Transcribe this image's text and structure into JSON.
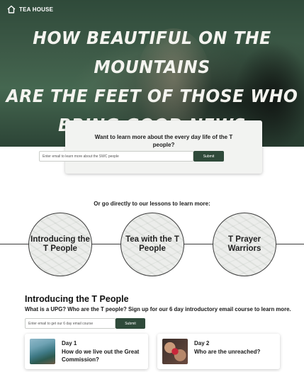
{
  "brand": {
    "name": "TEA HOUSE",
    "icon": "house-icon"
  },
  "hero": {
    "title_lines": [
      "How beautiful on the mountains",
      "are the feet of those who",
      "bring good news"
    ]
  },
  "signup": {
    "heading": "Want to learn more about the every day life of the T people?",
    "placeholder": "Enter email to learn more about the SWC people",
    "button": "Submit"
  },
  "lessons": {
    "intro": "Or go directly to our lessons to learn more:",
    "items": [
      {
        "label": "Introducing the T People"
      },
      {
        "label": "Tea with the T People"
      },
      {
        "label": "T Prayer Warriors"
      }
    ]
  },
  "course": {
    "title": "Introducing the T People",
    "subtitle": "What is a UPG? Who are the T people? Sign up for our 6 day introductory email course to learn more.",
    "placeholder": "Enter email to get our 6 day email course",
    "button": "Submit",
    "days": [
      {
        "day": "Day 1",
        "title": "How do we live out the Great Commission?"
      },
      {
        "day": "Day 2",
        "title": "Who are the unreached?"
      }
    ]
  },
  "colors": {
    "brand_green": "#2f4a3a"
  }
}
